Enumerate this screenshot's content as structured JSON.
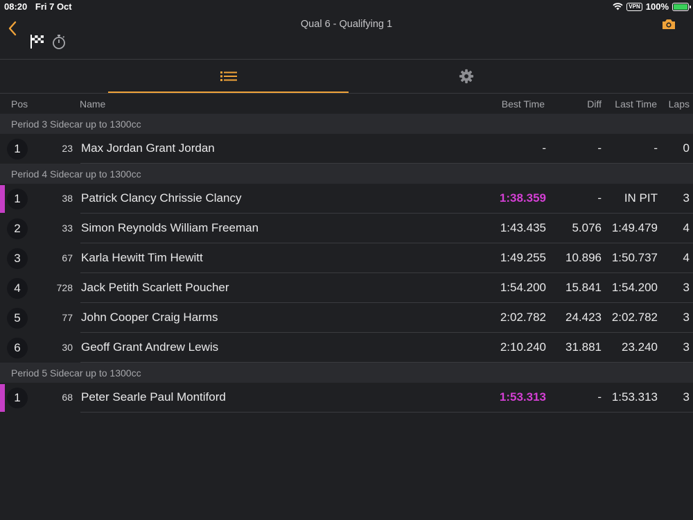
{
  "status_bar": {
    "time": "08:20",
    "date": "Fri 7 Oct",
    "vpn": "VPN",
    "battery": "100%"
  },
  "nav": {
    "title": "Qual 6  -  Qualifying 1"
  },
  "columns": {
    "pos": "Pos",
    "name": "Name",
    "best": "Best Time",
    "diff": "Diff",
    "last": "Last Time",
    "laps": "Laps"
  },
  "colors": {
    "accent": "#f0a33a",
    "fastest": "#d43fd4",
    "marker": "#c63fc6"
  },
  "groups": [
    {
      "title": "Period 3 Sidecar up to 1300cc",
      "rows": [
        {
          "pos": "1",
          "num": "23",
          "name": "Max Jordan Grant Jordan",
          "best": "-",
          "diff": "-",
          "last": "-",
          "laps": "0",
          "fast": false
        }
      ]
    },
    {
      "title": "Period 4 Sidecar up to 1300cc",
      "rows": [
        {
          "pos": "1",
          "num": "38",
          "name": "Patrick Clancy Chrissie Clancy",
          "best": "1:38.359",
          "diff": "-",
          "last": "IN PIT",
          "laps": "3",
          "fast": true
        },
        {
          "pos": "2",
          "num": "33",
          "name": "Simon Reynolds William Freeman",
          "best": "1:43.435",
          "diff": "5.076",
          "last": "1:49.479",
          "laps": "4",
          "fast": false
        },
        {
          "pos": "3",
          "num": "67",
          "name": "Karla Hewitt Tim Hewitt",
          "best": "1:49.255",
          "diff": "10.896",
          "last": "1:50.737",
          "laps": "4",
          "fast": false
        },
        {
          "pos": "4",
          "num": "728",
          "name": "Jack Petith Scarlett Poucher",
          "best": "1:54.200",
          "diff": "15.841",
          "last": "1:54.200",
          "laps": "3",
          "fast": false
        },
        {
          "pos": "5",
          "num": "77",
          "name": "John Cooper Craig Harms",
          "best": "2:02.782",
          "diff": "24.423",
          "last": "2:02.782",
          "laps": "3",
          "fast": false
        },
        {
          "pos": "6",
          "num": "30",
          "name": "Geoff Grant Andrew Lewis",
          "best": "2:10.240",
          "diff": "31.881",
          "last": "23.240",
          "laps": "3",
          "fast": false
        }
      ]
    },
    {
      "title": "Period 5 Sidecar up to 1300cc",
      "rows": [
        {
          "pos": "1",
          "num": "68",
          "name": "Peter Searle Paul Montiford",
          "best": "1:53.313",
          "diff": "-",
          "last": "1:53.313",
          "laps": "3",
          "fast": true
        }
      ]
    }
  ]
}
